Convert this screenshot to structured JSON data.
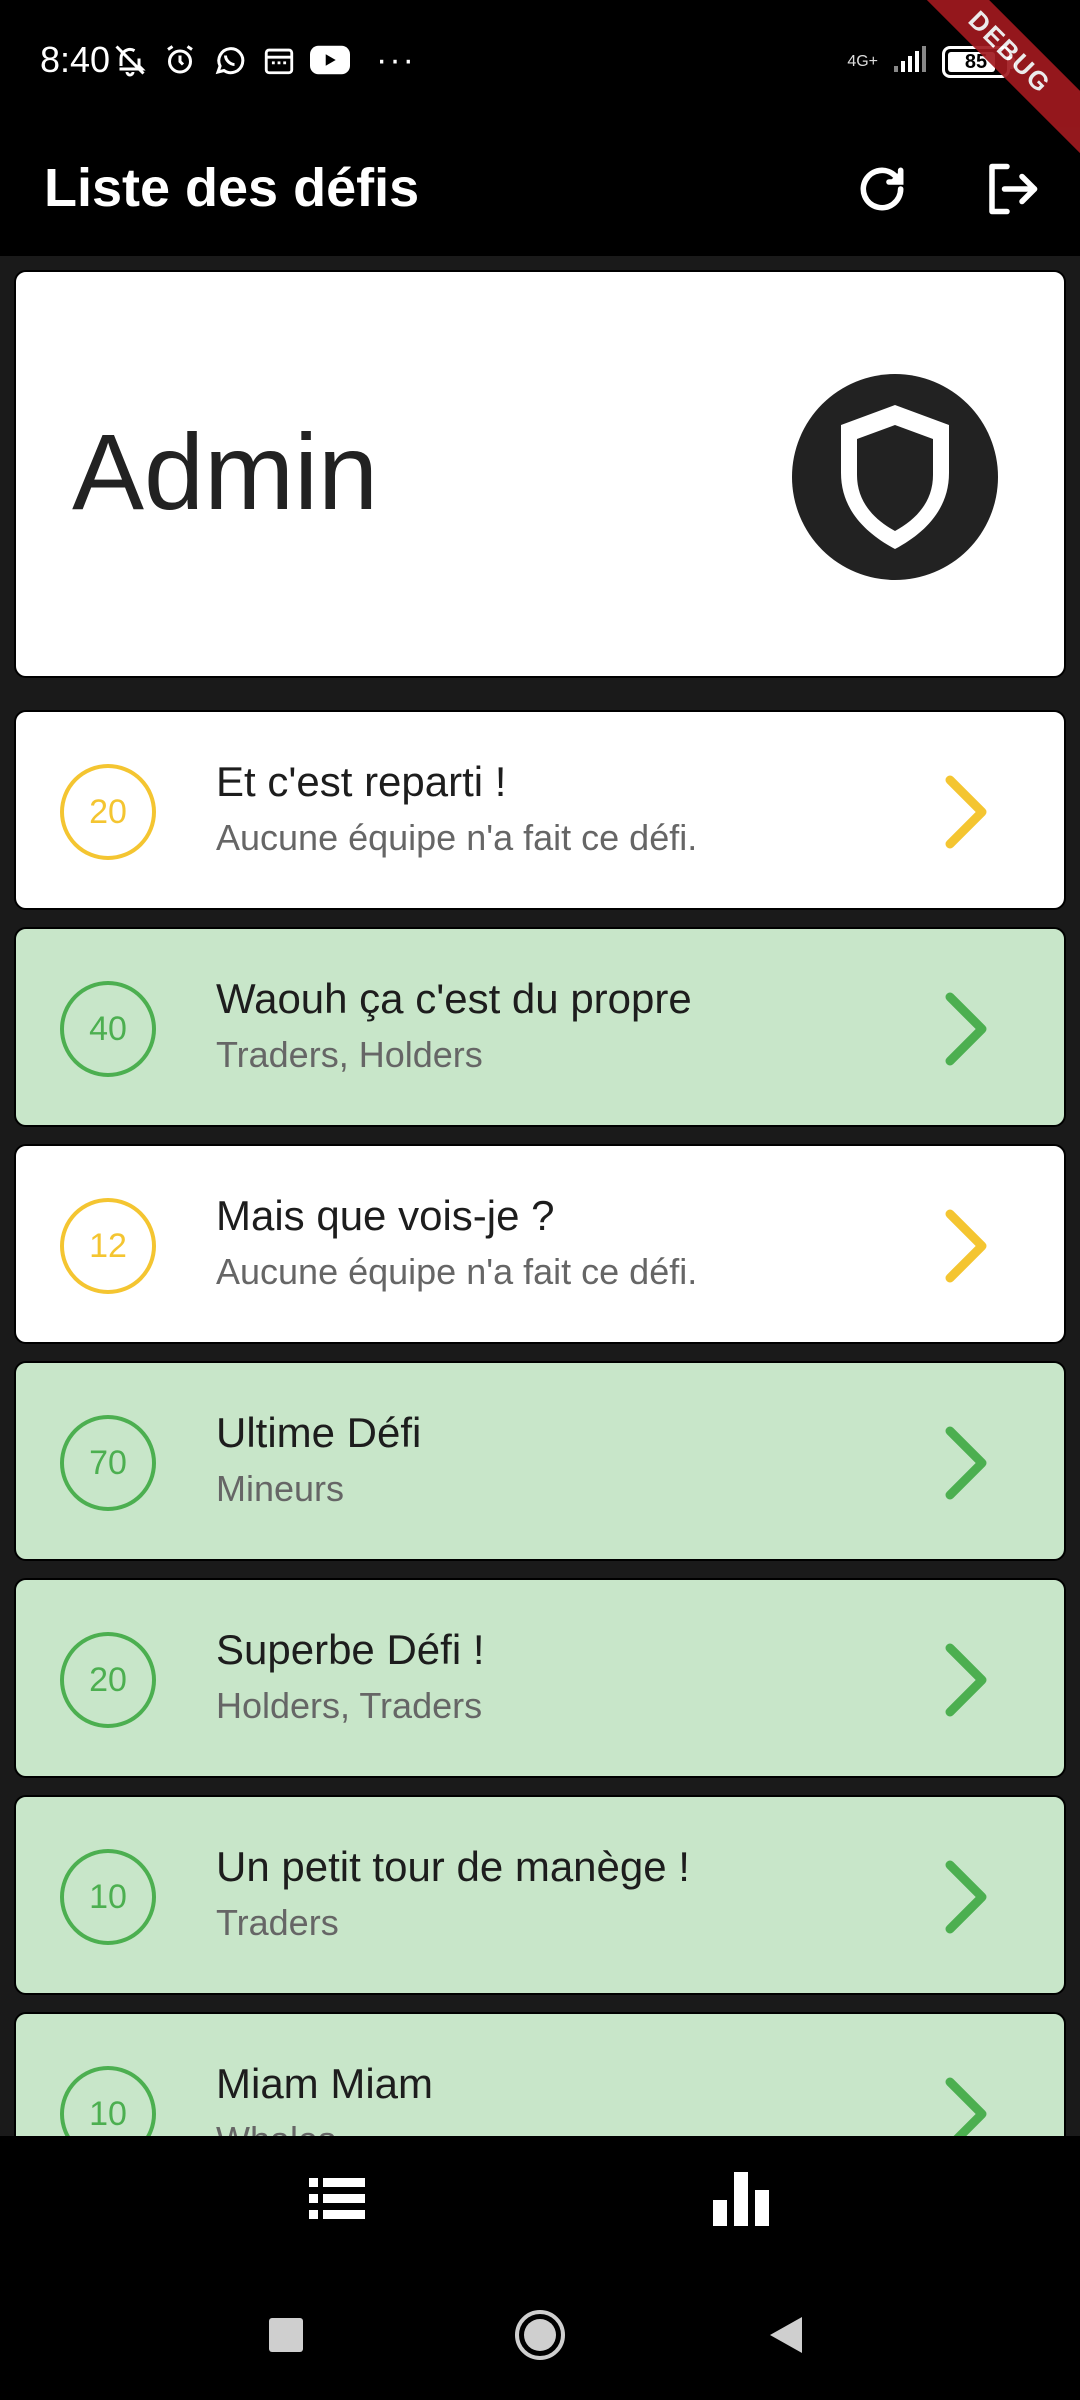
{
  "status_bar": {
    "time": "8:40",
    "network": "4G+",
    "battery": "85",
    "battery_level": 0.85,
    "icons_left": [
      "bell-off-icon",
      "alarm-icon",
      "whatsapp-icon",
      "calendar-icon",
      "youtube-icon"
    ],
    "overflow": "···"
  },
  "debug_banner": "DEBUG",
  "app_bar": {
    "title": "Liste des défis",
    "actions": [
      "refresh-icon",
      "logout-icon"
    ]
  },
  "admin_card": {
    "name": "Admin",
    "icon": "shield-icon"
  },
  "colors": {
    "pending_accent": "#f4c531",
    "done_accent": "#4caf50",
    "done_background": "#c8e6c9",
    "admin_badge": "#222222"
  },
  "challenges": [
    {
      "points": "20",
      "title": "Et c'est reparti !",
      "teams": "Aucune équipe n'a fait ce défi.",
      "status": "pending"
    },
    {
      "points": "40",
      "title": "Waouh ça c'est du propre",
      "teams": "Traders, Holders",
      "status": "done"
    },
    {
      "points": "12",
      "title": "Mais que vois-je ?",
      "teams": "Aucune équipe n'a fait ce défi.",
      "status": "pending"
    },
    {
      "points": "70",
      "title": "Ultime Défi",
      "teams": "Mineurs",
      "status": "done"
    },
    {
      "points": "20",
      "title": "Superbe Défi !",
      "teams": "Holders, Traders",
      "status": "done"
    },
    {
      "points": "10",
      "title": "Un petit tour de manège !",
      "teams": "Traders",
      "status": "done"
    },
    {
      "points": "10",
      "title": "Miam Miam",
      "teams": "Whales",
      "status": "done"
    }
  ],
  "bottom_nav": {
    "items": [
      "list-icon",
      "bar-chart-icon"
    ]
  },
  "system_nav": [
    "recents-icon",
    "home-icon",
    "back-icon"
  ]
}
